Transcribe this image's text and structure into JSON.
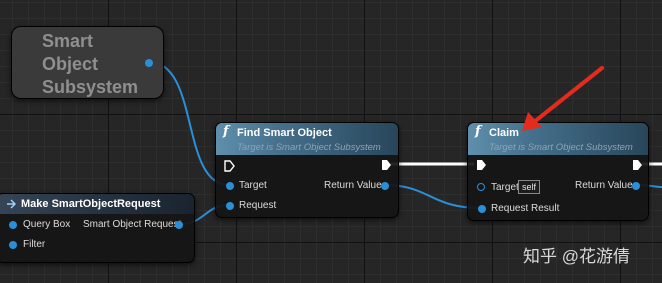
{
  "subsystem_node": {
    "lines": [
      "Smart",
      "Object",
      "Subsystem"
    ]
  },
  "find_node": {
    "icon": "function-icon",
    "title": "Find Smart Object",
    "subtitle": "Target is Smart Object Subsystem",
    "inputs": [
      "Target",
      "Request"
    ],
    "output": "Return Value"
  },
  "claim_node": {
    "icon": "function-icon",
    "title": "Claim",
    "subtitle": "Target is Smart Object Subsystem",
    "target_label": "Target",
    "target_value": "self",
    "input2": "Request Result",
    "output": "Return Value"
  },
  "make_node": {
    "title": "Make SmartObjectRequest",
    "inputs": [
      "Query Box",
      "Filter"
    ],
    "output": "Smart Object Request"
  },
  "watermark": "知乎 @花游倩",
  "colors": {
    "pin": "#2a8fd6",
    "arrow": "#e32b1e",
    "header_light": "#5f8fac",
    "header_dark": "#364656"
  }
}
